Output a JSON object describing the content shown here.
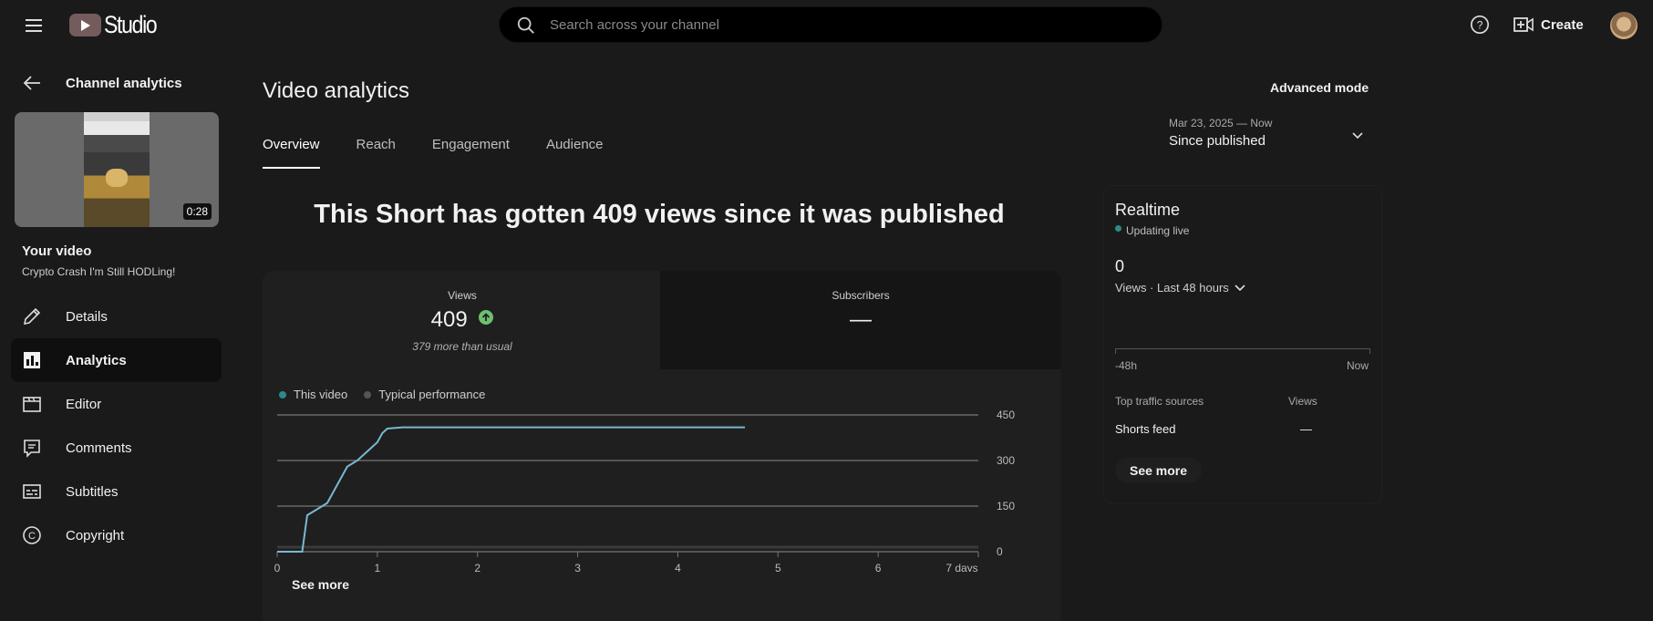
{
  "header": {
    "logo_text": "Studio",
    "search_placeholder": "Search across your channel",
    "create_label": "Create"
  },
  "sidebar": {
    "back_label": "Channel analytics",
    "thumbnail_duration": "0:28",
    "your_video_label": "Your video",
    "video_title": "Crypto Crash I'm Still HODLing!",
    "items": [
      {
        "label": "Details",
        "icon": "pencil-icon",
        "active": false
      },
      {
        "label": "Analytics",
        "icon": "analytics-icon",
        "active": true
      },
      {
        "label": "Editor",
        "icon": "clapperboard-icon",
        "active": false
      },
      {
        "label": "Comments",
        "icon": "comment-icon",
        "active": false
      },
      {
        "label": "Subtitles",
        "icon": "subtitles-icon",
        "active": false
      },
      {
        "label": "Copyright",
        "icon": "copyright-icon",
        "active": false
      }
    ]
  },
  "main": {
    "title": "Video analytics",
    "tabs": [
      "Overview",
      "Reach",
      "Engagement",
      "Audience"
    ],
    "active_tab": "Overview",
    "headline": "This Short has gotten 409 views since it was published",
    "metrics": {
      "views_label": "Views",
      "views_value": "409",
      "views_note": "379 more than usual",
      "subscribers_label": "Subscribers",
      "subscribers_value": "—"
    },
    "legend": {
      "this_video": "This video",
      "typical": "Typical performance"
    },
    "see_more": "See more"
  },
  "chart_data": {
    "type": "line",
    "x_tick_labels": [
      "0",
      "1",
      "2",
      "3",
      "4",
      "5",
      "6",
      "7 days"
    ],
    "y_tick_labels": [
      "450",
      "300",
      "150",
      "0"
    ],
    "xlim": [
      0,
      7
    ],
    "ylim": [
      0,
      450
    ],
    "series": [
      {
        "name": "This video",
        "color": "#7ab8d0",
        "x": [
          0,
          0.25,
          0.3,
          0.4,
          0.5,
          0.6,
          0.7,
          0.8,
          0.9,
          1.0,
          1.05,
          1.1,
          1.25,
          2,
          3,
          4,
          4.67
        ],
        "y": [
          0,
          0,
          120,
          140,
          160,
          220,
          280,
          300,
          330,
          360,
          390,
          405,
          409,
          409,
          409,
          409,
          409
        ]
      },
      {
        "name": "Typical performance",
        "color": "#3a3a3a",
        "x": [
          0,
          7
        ],
        "y": [
          15,
          15
        ]
      }
    ],
    "grid": true,
    "legend_position": "top-left"
  },
  "right_panel": {
    "advanced_mode": "Advanced mode",
    "date_sub": "Mar 23, 2025 — Now",
    "date_main": "Since published",
    "realtime": {
      "title": "Realtime",
      "live_label": "Updating live",
      "value": "0",
      "metric_label": "Views · Last 48 hours",
      "axis_start": "-48h",
      "axis_end": "Now",
      "table_header_source": "Top traffic sources",
      "table_header_views": "Views",
      "row_source": "Shorts feed",
      "row_views": "—",
      "see_more": "See more"
    }
  },
  "colors": {
    "background": "#1a1a1a",
    "card": "#1f1f1f",
    "accent_line": "#7ab8d0",
    "positive": "#6cc070",
    "live_dot": "#2e8a8a"
  }
}
